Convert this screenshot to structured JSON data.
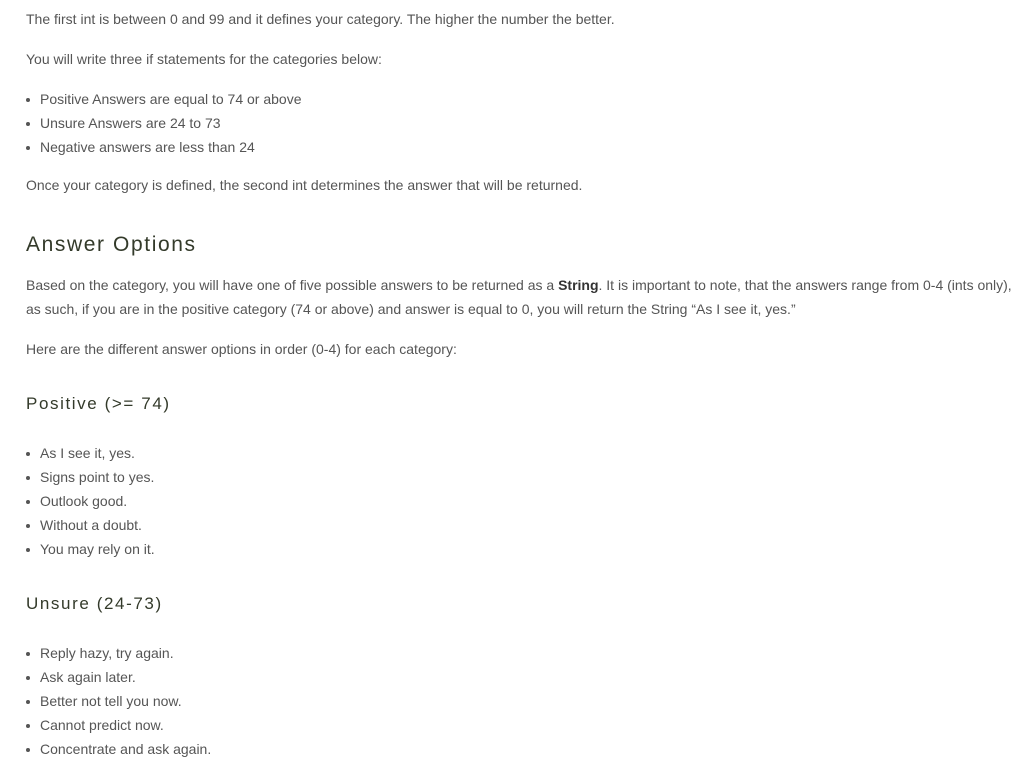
{
  "intro": {
    "p1": "The first int is between 0 and 99 and it defines your category. The higher the number the better.",
    "p2": "You will write three if statements for the categories below:",
    "categories": [
      "Positive Answers are equal to 74 or above",
      "Unsure Answers are 24 to 73",
      "Negative answers are less than 24"
    ],
    "p3": "Once your category is defined, the second int determines the answer that will be returned."
  },
  "answer_options": {
    "heading": "Answer Options",
    "p1_before": "Based on the category, you will have one of five possible answers to be returned as a ",
    "p1_bold": "String",
    "p1_after": ". It is important to note, that the answers range from 0-4 (ints only), as such, if you are in the positive category (74 or above) and answer is equal to 0, you will return the String “As I see it, yes.”",
    "p2": "Here are the different answer options in order (0-4) for each category:"
  },
  "positive": {
    "heading": "Positive (>= 74)",
    "answers": [
      "As I see it, yes.",
      "Signs point to yes.",
      "Outlook good.",
      "Without a doubt.",
      "You may rely on it."
    ]
  },
  "unsure": {
    "heading": "Unsure (24-73)",
    "answers": [
      "Reply hazy, try again.",
      "Ask again later.",
      "Better not tell you now.",
      "Cannot predict now.",
      "Concentrate and ask again."
    ]
  }
}
